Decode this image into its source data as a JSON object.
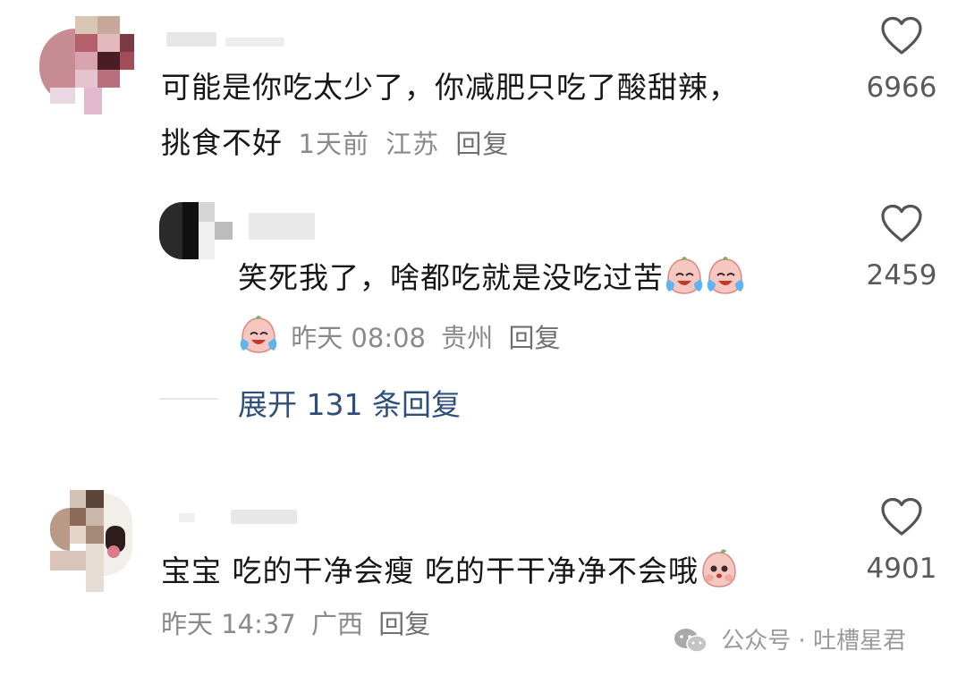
{
  "comments": [
    {
      "text_line1": "可能是你吃太少了，你减肥只吃了酸甜辣，",
      "text_line2": "挑食不好",
      "time": "1天前",
      "location": "江苏",
      "reply_label": "回复",
      "likes": "6966"
    },
    {
      "text": "笑死我了，啥都吃就是没吃过苦",
      "time": "昨天 08:08",
      "location": "贵州",
      "reply_label": "回复",
      "likes": "2459"
    },
    {
      "text": "宝宝 吃的干净会瘦 吃的干干净净不会哦",
      "time": "昨天 14:37",
      "location": "广西",
      "reply_label": "回复",
      "likes": "4901"
    }
  ],
  "expand_replies": "展开 131 条回复",
  "watermark": "公众号 · 吐槽星君",
  "icons": {
    "like": "heart-outline-icon",
    "emoji_cry": "crying-laughing-emoji-icon",
    "emoji_shy": "shy-emoji-icon",
    "watermark_logo": "wechat-icon"
  },
  "colors": {
    "text": "#161616",
    "meta": "#8a8a8a",
    "link": "#2e4f7c"
  }
}
